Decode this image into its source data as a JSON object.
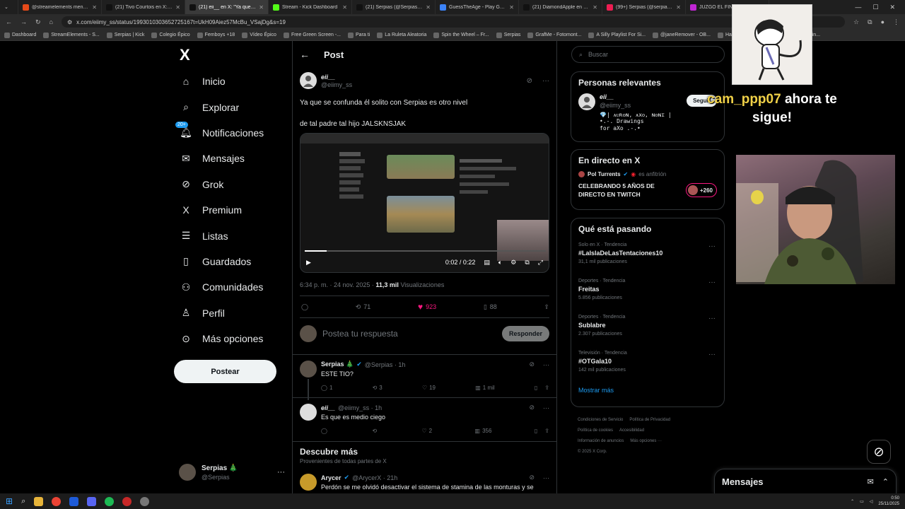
{
  "browser": {
    "tabs": [
      {
        "label": "@streamelements mention",
        "color": "#e64a19"
      },
      {
        "label": "(21) Tivo Courtois en X: \"me ac",
        "color": "#111111"
      },
      {
        "label": "(21) eii__ en X: \"Ya que se c",
        "color": "#111111",
        "active": true
      },
      {
        "label": "Stream - Kick Dashboard",
        "color": "#53fc18"
      },
      {
        "label": "(21) Serpias (@Serpias) / X",
        "color": "#111111"
      },
      {
        "label": "GuessTheAge - Play Guess The",
        "color": "#3b82f6"
      },
      {
        "label": "(21) DiamondApple en X: \"esto",
        "color": "#111111"
      },
      {
        "label": "(99+) Serpias (@serpias) | TikTok",
        "color": "#ee1d52"
      },
      {
        "label": "JUZGO EL FINA",
        "color": "#c026d3"
      }
    ],
    "url": "x.com/eiimy_ss/status/1993010303652725167t=UkH09Aiez57McBu_VSajDg&s=19",
    "bookmarks": [
      "Dashboard",
      "StreamElements - S...",
      "Serpias | Kick",
      "Colegio Épico",
      "Femboys +18",
      "Vídeo Épico",
      "Free Green Screen -...",
      "Para ti",
      "La Ruleta Aleatoria",
      "Spin the Wheel – Fr...",
      "Serpias",
      "GrafMe - Fotomont...",
      "A Silly Playlist For Si...",
      "@janeRemover - OB...",
      "Hay ahora ti",
      "THE BEST CS2 Settin..."
    ]
  },
  "nav": {
    "logo": "X",
    "items": [
      {
        "label": "Inicio",
        "icon": "home-icon"
      },
      {
        "label": "Explorar",
        "icon": "search-icon"
      },
      {
        "label": "Notificaciones",
        "icon": "bell-icon",
        "badge": "20+"
      },
      {
        "label": "Mensajes",
        "icon": "mail-icon"
      },
      {
        "label": "Grok",
        "icon": "grok-icon"
      },
      {
        "label": "Premium",
        "icon": "x-premium-icon"
      },
      {
        "label": "Listas",
        "icon": "list-icon"
      },
      {
        "label": "Guardados",
        "icon": "bookmark-icon"
      },
      {
        "label": "Comunidades",
        "icon": "communities-icon"
      },
      {
        "label": "Perfil",
        "icon": "profile-icon"
      },
      {
        "label": "Más opciones",
        "icon": "more-circle-icon"
      }
    ],
    "post_button": "Postear",
    "account": {
      "name": "Serpias 🎄",
      "handle": "@Serpias"
    }
  },
  "post": {
    "header_title": "Post",
    "author_name": "eii__",
    "author_handle": "@eiimy_ss",
    "text_line1": "Ya que se confunda él solito con Serpias es otro nivel",
    "text_line2": "de tal padre tal hijo JALSKNSJAK",
    "video_time": "0:02 / 0:22",
    "video_progress": 0.09,
    "timestamp": "6:34 p. m. · 24 nov. 2025 · ",
    "views_count": "11,3 mil",
    "views_label": "Visualizaciones",
    "stats": {
      "reposts": "71",
      "likes": "923",
      "bookmarks": "88"
    },
    "reply_placeholder": "Postea tu respuesta",
    "reply_button": "Responder"
  },
  "replies": [
    {
      "name": "Serpias 🎄",
      "handle": "@Serpias · 1h",
      "verified": true,
      "text": "ESTE TIO?",
      "replies": "1",
      "reposts": "3",
      "likes": "19",
      "views": "1 mil"
    },
    {
      "name": "eii__",
      "handle": "@eiimy_ss · 1h",
      "verified": false,
      "text": "Es que es medio ciego",
      "replies": "",
      "reposts": "",
      "likes": "2",
      "views": "356"
    }
  ],
  "discover": {
    "title": "Descubre más",
    "subtitle": "Provenientes de todas partes de X",
    "post": {
      "name": "Arycer",
      "handle": "@ArycerX · 21h",
      "text": "Perdón se me olvidó desactivar el sistema de stamina de las monturas y se"
    }
  },
  "sidebar": {
    "search_placeholder": "Buscar",
    "relevant": {
      "title": "Personas relevantes",
      "name": "eii__",
      "handle": "@eiimy_ss",
      "bio_line1": "💎| ᴀᴜʀᴏɴ, ᴀxᴏ, ɴᴏɴɪ | •.-. Drawings",
      "bio_line2": "for aXo .-.•",
      "follow": "Seguir"
    },
    "live": {
      "title": "En directo en X",
      "host": "Pol Turrents",
      "host_suffix": "es anfitrión",
      "title_line1": "CELEBRANDO 5 AÑOS DE",
      "title_line2": "DIRECTO EN TWITCH",
      "listeners": "+260"
    },
    "trends": {
      "title": "Qué está pasando",
      "items": [
        {
          "category": "Solo en X · Tendencia",
          "name": "#LaIslaDeLasTentaciones10",
          "count": "31,1 mil publicaciones"
        },
        {
          "category": "Deportes · Tendencia",
          "name": "Freitas",
          "count": "5.856 publicaciones"
        },
        {
          "category": "Deportes · Tendencia",
          "name": "Sublabre",
          "count": "2.307 publicaciones"
        },
        {
          "category": "Televisión · Tendencia",
          "name": "#OTGala10",
          "count": "142 mil publicaciones"
        }
      ],
      "show_more": "Mostrar más"
    },
    "footer": [
      "Condiciones de Servicio",
      "Política de Privacidad",
      "Política de cookies",
      "Accesibilidad",
      "Información de anuncios",
      "Más opciones ···",
      "© 2025 X Corp."
    ]
  },
  "stream_overlay": {
    "follow_user": "cam_ppp07",
    "follow_text1": " ahora te",
    "follow_text2": "sigue!"
  },
  "messages_bar": {
    "title": "Mensajes"
  },
  "tray": {
    "time": "0:50",
    "date": "25/11/2025"
  },
  "colors": {
    "accent": "#1d9bf0",
    "like": "#f91880",
    "bg": "#000000",
    "border": "#2f3336",
    "muted": "#71767b"
  }
}
